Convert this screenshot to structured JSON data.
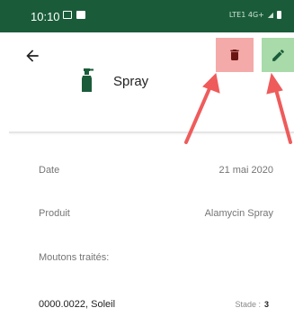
{
  "status_bar": {
    "time": "10:10",
    "right_text": "LTE1 4G+",
    "background": "#1a5c3a"
  },
  "header": {
    "title": "Spray",
    "delete_color": "#f4aaa9",
    "edit_color": "#a8dba9",
    "accent": "#1a5c3a"
  },
  "details": {
    "date_label": "Date",
    "date_value": "21 mai 2020",
    "product_label": "Produit",
    "product_value": "Alamycin Spray",
    "treated_label": "Moutons traités:"
  },
  "sheep": [
    {
      "id": "0000.0022, Soleil",
      "stade_label": "Stade :",
      "stade_value": "3"
    }
  ],
  "annotation_color": "#ef5b5b"
}
